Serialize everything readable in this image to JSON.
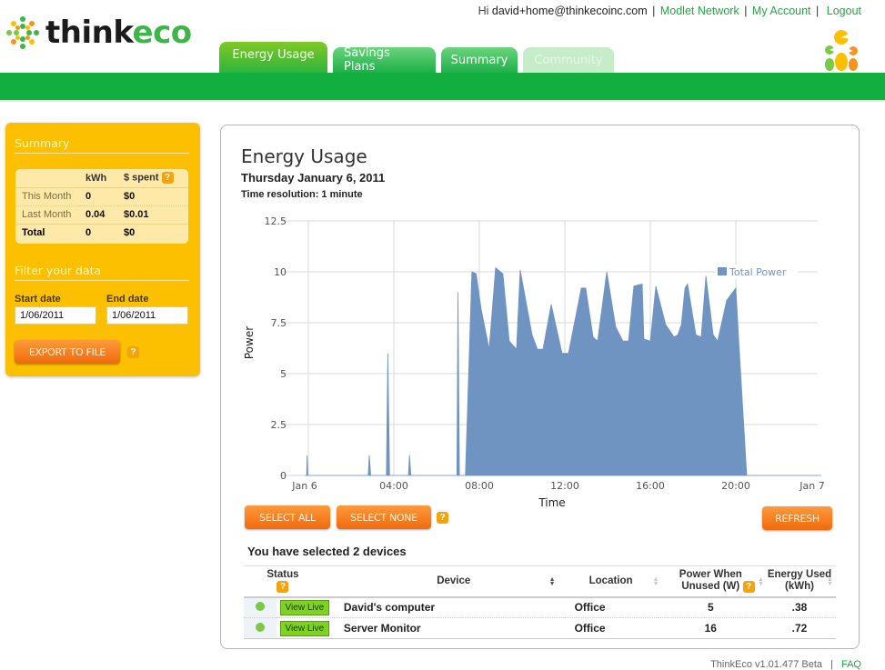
{
  "brand": {
    "name_part1": "think",
    "name_part2": "eco"
  },
  "topnav": {
    "greeting": "Hi",
    "user_email": "david+home@thinkecoinc.com",
    "links": [
      "Modlet Network",
      "My Account",
      "Logout"
    ],
    "separator": "|"
  },
  "tabs": [
    {
      "label": "Energy Usage",
      "state": "active"
    },
    {
      "label": "Savings Plans",
      "state": "normal"
    },
    {
      "label": "Summary",
      "state": "normal"
    },
    {
      "label": "Community",
      "state": "disabled"
    }
  ],
  "sidebar": {
    "summary_title": "Summary",
    "summary_table": {
      "headers": [
        "",
        "kWh",
        "$ spent"
      ],
      "help_icon": "?",
      "rows": [
        {
          "label": "This Month",
          "kwh": "0",
          "spent": "$0"
        },
        {
          "label": "Last Month",
          "kwh": "0.04",
          "spent": "$0.01"
        },
        {
          "label": "Total",
          "kwh": "0",
          "spent": "$0"
        }
      ]
    },
    "filter_title": "Filter your data",
    "start_date_label": "Start date",
    "start_date_value": "1/06/2011",
    "end_date_label": "End date",
    "end_date_value": "1/06/2011",
    "export_label": "EXPORT TO FILE",
    "help_icon": "?"
  },
  "panel": {
    "title": "Energy Usage",
    "date": "Thursday January 6, 2011",
    "resolution": "Time resolution: 1 minute",
    "select_all_label": "SELECT ALL",
    "select_none_label": "SELECT NONE",
    "refresh_label": "REFRESH",
    "help_icon": "?",
    "selected_text": "You have selected 2 devices"
  },
  "chart_data": {
    "type": "area",
    "title": "",
    "xlabel": "Time",
    "ylabel": "Power",
    "x_unit": "hours since Jan 6 00:00",
    "xlim": [
      -0.15,
      24
    ],
    "ylim": [
      0,
      12.5
    ],
    "yticks": [
      0,
      2.5,
      5,
      7.5,
      10,
      12.5
    ],
    "ytick_labels": [
      "0",
      "2.5",
      "5",
      "7.5",
      "10",
      "12.5"
    ],
    "xticks": [
      0,
      4,
      8,
      12,
      16,
      20,
      24
    ],
    "xtick_labels": [
      "Jan 6",
      "04:00",
      "08:00",
      "12:00",
      "16:00",
      "20:00",
      "Jan 7"
    ],
    "grid": true,
    "legend": {
      "position": "top-right",
      "entries": [
        "Total Power"
      ]
    },
    "series": [
      {
        "name": "Total Power",
        "color": "#7094c2",
        "points": [
          [
            -0.15,
            0
          ],
          [
            -0.08,
            0
          ],
          [
            -0.06,
            1.0
          ],
          [
            -0.02,
            0
          ],
          [
            2.8,
            0
          ],
          [
            2.85,
            1.0
          ],
          [
            2.92,
            0
          ],
          [
            3.65,
            0
          ],
          [
            3.72,
            6.0
          ],
          [
            3.8,
            0
          ],
          [
            4.68,
            0
          ],
          [
            4.73,
            1.0
          ],
          [
            4.8,
            0
          ],
          [
            6.95,
            0
          ],
          [
            7.0,
            9.0
          ],
          [
            7.07,
            0
          ],
          [
            7.35,
            0
          ],
          [
            7.65,
            10.0
          ],
          [
            7.85,
            9.9
          ],
          [
            8.08,
            8.2
          ],
          [
            8.46,
            6.2
          ],
          [
            8.76,
            10.2
          ],
          [
            9.1,
            9.9
          ],
          [
            9.4,
            6.6
          ],
          [
            9.74,
            6.2
          ],
          [
            9.91,
            10.1
          ],
          [
            10.47,
            6.9
          ],
          [
            10.72,
            6.2
          ],
          [
            10.98,
            6.2
          ],
          [
            11.36,
            8.4
          ],
          [
            11.87,
            6.0
          ],
          [
            12.17,
            6.0
          ],
          [
            12.77,
            9.2
          ],
          [
            12.98,
            9.2
          ],
          [
            13.32,
            6.8
          ],
          [
            13.53,
            6.6
          ],
          [
            13.96,
            10.0
          ],
          [
            14.38,
            7.3
          ],
          [
            14.72,
            6.6
          ],
          [
            14.98,
            6.6
          ],
          [
            15.23,
            9.3
          ],
          [
            15.62,
            9.4
          ],
          [
            15.7,
            6.7
          ],
          [
            16.0,
            6.6
          ],
          [
            16.26,
            9.3
          ],
          [
            16.72,
            7.4
          ],
          [
            17.11,
            6.8
          ],
          [
            17.28,
            6.9
          ],
          [
            17.45,
            7.4
          ],
          [
            17.62,
            9.2
          ],
          [
            17.74,
            9.4
          ],
          [
            18.13,
            6.9
          ],
          [
            18.38,
            6.8
          ],
          [
            18.6,
            9.8
          ],
          [
            18.94,
            6.9
          ],
          [
            19.15,
            6.6
          ],
          [
            19.57,
            8.6
          ],
          [
            20.0,
            9.2
          ],
          [
            20.17,
            6.0
          ],
          [
            20.51,
            0
          ],
          [
            24.0,
            0
          ]
        ]
      }
    ]
  },
  "device_table": {
    "columns": [
      "Status",
      "Device",
      "Location",
      "Power When Unused  (W)",
      "Energy Used (kWh)"
    ],
    "status_help_icon": "?",
    "power_help_icon": "?",
    "rows": [
      {
        "status": "online",
        "view_live_label": "View Live",
        "device": "David's computer",
        "location": "Office",
        "power_unused": "5",
        "energy_used": ".38"
      },
      {
        "status": "online",
        "view_live_label": "View Live",
        "device": "Server Monitor",
        "location": "Office",
        "power_unused": "16",
        "energy_used": ".72"
      }
    ]
  },
  "footer": {
    "version": "ThinkEco v1.01.477 Beta",
    "separator": "|",
    "faq_label": "FAQ"
  }
}
